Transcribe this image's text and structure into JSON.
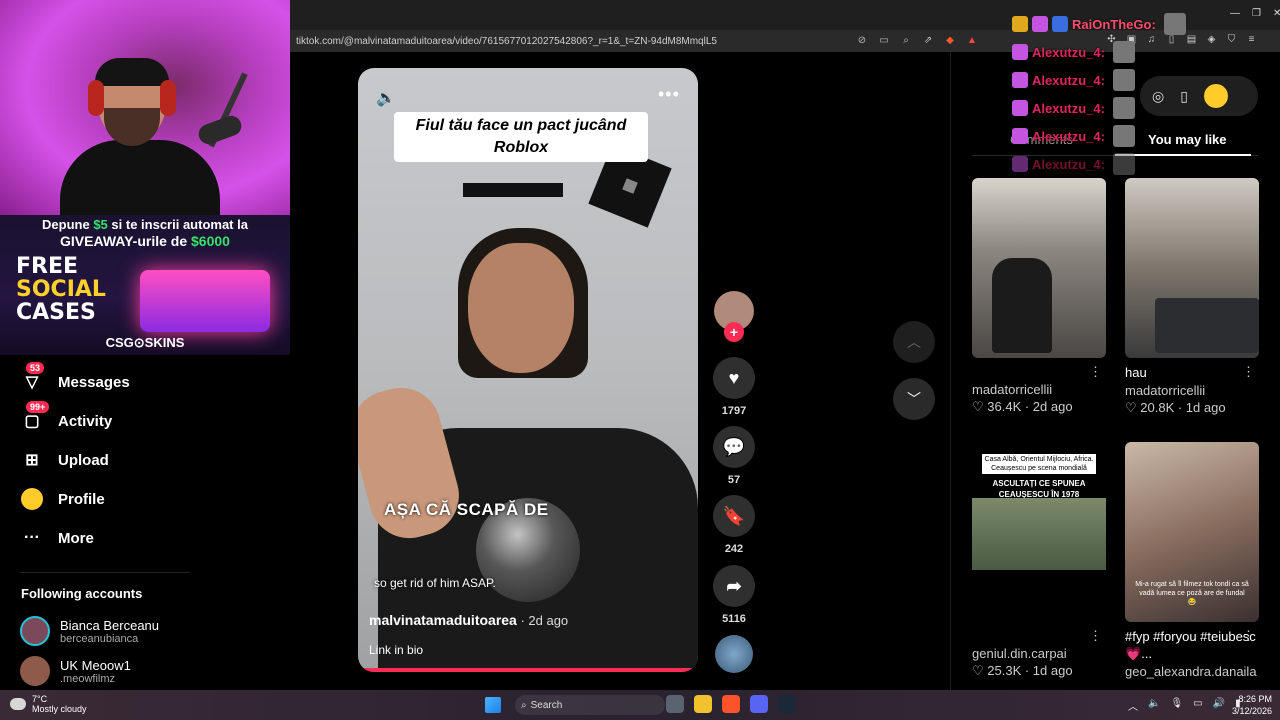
{
  "browser": {
    "url": "tiktok.com/@malvinatamaduitoarea/video/7615677012027542806?_r=1&_t=ZN-94dM8MmqlL5"
  },
  "stream_overlay": {
    "promo_line1_a": "Depune ",
    "promo_line1_b": "$5",
    "promo_line1_c": " si te inscrii automat la",
    "promo_line2_a": "GIVEAWAY-urile de ",
    "promo_line2_b": "$6000",
    "free_line1": "FREE",
    "free_line2": "SOCIAL",
    "free_line3": "CASES",
    "brand": "CSG⊙SKINS"
  },
  "chat": [
    {
      "name": "RaiOnTheGo:"
    },
    {
      "name": "Alexutzu_4:"
    },
    {
      "name": "Alexutzu_4:"
    },
    {
      "name": "Alexutzu_4:"
    },
    {
      "name": "Alexutzu_4:"
    },
    {
      "name": "Alexutzu_4:"
    }
  ],
  "sidebar": {
    "messages": {
      "label": "Messages",
      "badge": "53"
    },
    "activity": {
      "label": "Activity",
      "badge": "99+"
    },
    "upload": {
      "label": "Upload"
    },
    "profile": {
      "label": "Profile"
    },
    "more": {
      "label": "More"
    },
    "following_title": "Following accounts",
    "accounts": [
      {
        "name": "Bianca Berceanu",
        "handle": "berceanubianca"
      },
      {
        "name": "UK Meoow1",
        "handle": ".meowfilmz"
      }
    ]
  },
  "video": {
    "title_overlay": "Fiul tău face un pact jucând Roblox",
    "caption_big": "AȘA CĂ SCAPĂ DE",
    "caption_sub": "so get rid of him ASAP.",
    "author": "malvinatamaduitoarea",
    "date": " · 2d ago",
    "link": "Link in bio"
  },
  "actions": {
    "likes": "1797",
    "comments": "57",
    "saves": "242",
    "shares": "5116"
  },
  "right_panel": {
    "tab_comments": "Comments",
    "tab_may_like": "You may like",
    "cards": [
      {
        "title": "",
        "author": "madatorricellii",
        "stats": "♡ 36.4K · 2d ago"
      },
      {
        "title": "hau",
        "author": "madatorricellii",
        "stats": "♡ 20.8K · 1d ago"
      },
      {
        "title": "",
        "author": "geniul.din.carpai",
        "stats": "♡ 25.3K · 1d ago",
        "thumb_text_1": "Casa Albă, Orientul Mijlociu, Africa. Ceaușescu pe scena mondială",
        "thumb_text_2": "ASCULTAȚI CE SPUNEA CEAUȘESCU ÎN 1978"
      },
      {
        "title": "#fyp #foryou #teiubesc💗...",
        "author": "geo_alexandra.danaila",
        "stats": "",
        "thumb_text": "Mi-a rugat să îl filmez tok tondi ca să vadă lumea ce poză are de fundal 😂"
      }
    ]
  },
  "taskbar": {
    "temp": "7°C",
    "weather": "Mostly cloudy",
    "search": "Search",
    "time": "8:26 PM",
    "date": "3/12/2026"
  },
  "colors": {
    "accent": "#fe2c55",
    "bg": "#000000"
  }
}
